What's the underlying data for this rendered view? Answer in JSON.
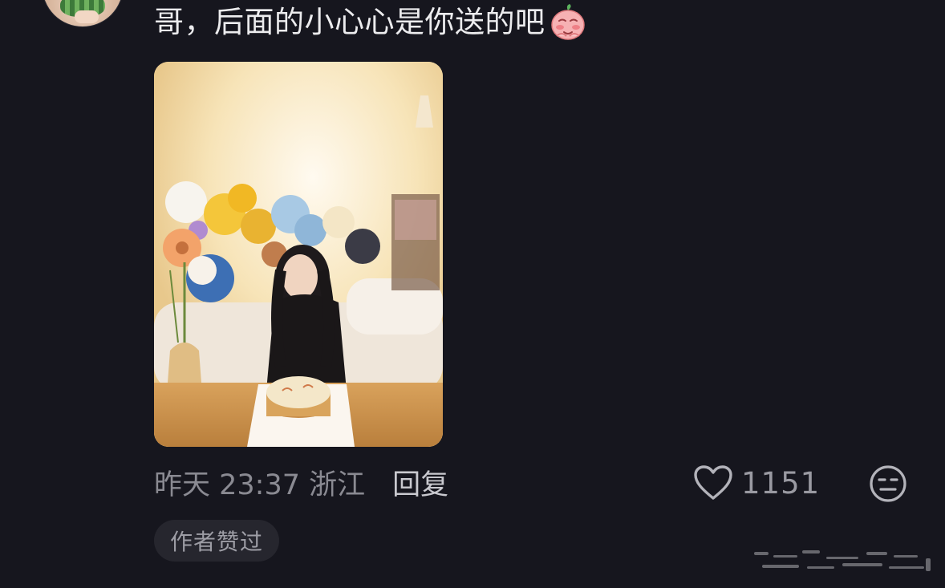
{
  "comment": {
    "text": "哥，后面的小心心是你送的吧",
    "emoji": "blushing-face-emoji"
  },
  "meta": {
    "time_location": "昨天 23:37 浙江",
    "reply_label": "回复"
  },
  "like": {
    "count": "1151",
    "icon": "heart-outline-icon"
  },
  "dislike": {
    "icon": "neutral-face-icon"
  },
  "badge": {
    "label": "作者赞过"
  },
  "colors": {
    "background": "#16161e",
    "text_primary": "#ececee",
    "text_secondary": "#8a8a92",
    "badge_bg": "#26262e"
  }
}
